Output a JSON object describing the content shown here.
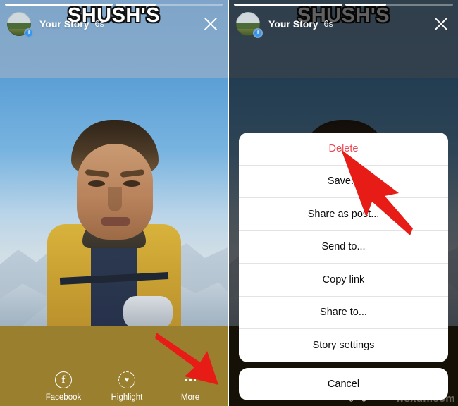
{
  "story": {
    "user_name": "Your Story",
    "time_ago": "6s",
    "sticker_text": "SHUSH'S",
    "avatar_badge": "+",
    "progress_segments": [
      100,
      38
    ],
    "close_icon": "close-icon"
  },
  "toolbar": {
    "items": [
      {
        "label": "Facebook",
        "icon": "facebook-icon",
        "glyph": "f"
      },
      {
        "label": "Highlight",
        "icon": "highlight-heart-icon",
        "glyph": "♥"
      },
      {
        "label": "More",
        "icon": "more-ellipsis-icon",
        "glyph": "•••"
      }
    ]
  },
  "action_sheet": {
    "items": [
      {
        "label": "Delete",
        "style": "destructive"
      },
      {
        "label": "Save...",
        "style": "default"
      },
      {
        "label": "Share as post...",
        "style": "default"
      },
      {
        "label": "Send to...",
        "style": "default"
      },
      {
        "label": "Copy link",
        "style": "default"
      },
      {
        "label": "Share to...",
        "style": "default"
      },
      {
        "label": "Story settings",
        "style": "default"
      }
    ],
    "cancel_label": "Cancel"
  },
  "annotations": {
    "arrow_color": "#e81c16",
    "left_arrow_target": "More",
    "right_arrow_target": "Delete"
  },
  "watermark": {
    "text": "wsxdn.com"
  },
  "colors": {
    "destructive": "#ed4956",
    "accent_blue": "#3897f0",
    "header_bg": "#7ea5c9",
    "bottom_bg": "#9a7f2e",
    "bottom_bg_dim": "#3a2f12"
  }
}
